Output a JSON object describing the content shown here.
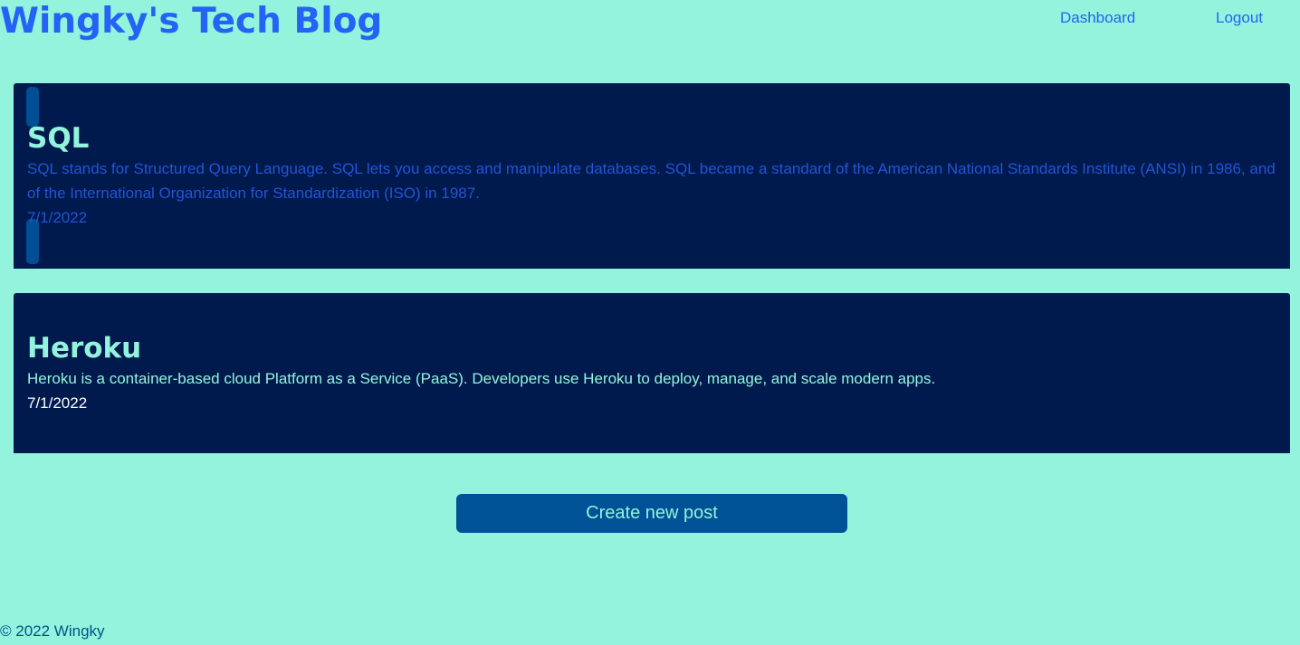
{
  "header": {
    "site_title": "Wingky's Tech Blog",
    "nav": {
      "dashboard_label": "Dashboard",
      "logout_label": "Logout"
    }
  },
  "posts": [
    {
      "title": "SQL",
      "body": "SQL stands for Structured Query Language. SQL lets you access and manipulate databases. SQL became a standard of the American National Standards Institute (ANSI) in 1986, and of the International Organization for Standardization (ISO) in 1987.",
      "date": "7/1/2022"
    },
    {
      "title": "Heroku",
      "body": "Heroku is a container-based cloud Platform as a Service (PaaS). Developers use Heroku to deploy, manage, and scale modern apps.",
      "date": "7/1/2022"
    }
  ],
  "actions": {
    "create_post_label": "Create new post"
  },
  "footer": {
    "copyright": "© 2022 Wingky"
  },
  "colors": {
    "background": "#93f3dc",
    "card_background": "#001a4d",
    "accent_blue": "#2463f5",
    "button_background": "#005296",
    "footer_text": "#00548a"
  }
}
